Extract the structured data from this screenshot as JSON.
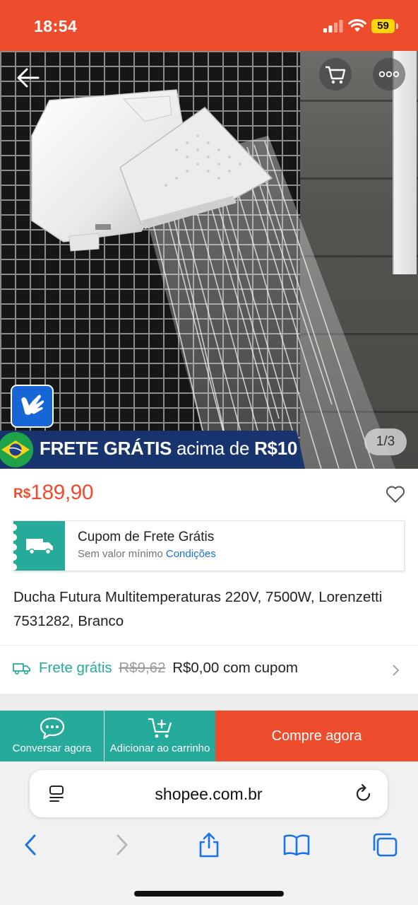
{
  "status_bar": {
    "time": "18:54",
    "battery": "59"
  },
  "product": {
    "image_counter": "1/3",
    "promo_banner": {
      "bold_1": "FRETE GRÁTIS",
      "light": "acima de",
      "bold_2": "R$10"
    },
    "price": {
      "currency": "R$",
      "value": "189,90"
    },
    "coupon": {
      "title": "Cupom de Frete Grátis",
      "subtitle": "Sem valor mínimo",
      "link": "Condições"
    },
    "title": "Ducha Futura Multitemperaturas 220V, 7500W, Lorenzetti 7531282, Branco",
    "shipping": {
      "label": "Frete grátis",
      "old_price": "R$9,62",
      "new_price": "R$0,00 com cupom"
    }
  },
  "actions": {
    "chat": "Conversar agora",
    "add_to_cart": "Adicionar ao carrinho",
    "buy_now": "Compre agora"
  },
  "browser": {
    "url": "shopee.com.br"
  },
  "colors": {
    "brand": "#ee4d2d",
    "teal": "#26aa99",
    "link": "#1b6fd8",
    "banner_navy": "#17346e"
  },
  "icons": [
    "back-arrow-icon",
    "cart-icon",
    "more-icon",
    "libras-hand-icon",
    "brazil-flag-icon",
    "heart-icon",
    "truck-icon",
    "chat-icon",
    "cart-plus-icon",
    "reader-icon",
    "reload-icon",
    "browser-back-icon",
    "browser-forward-icon",
    "share-icon",
    "bookmarks-icon",
    "tabs-icon"
  ]
}
